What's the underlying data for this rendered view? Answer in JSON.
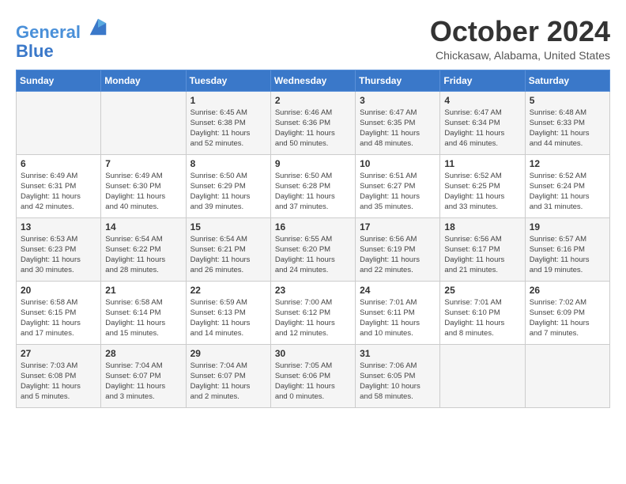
{
  "header": {
    "logo_line1": "General",
    "logo_line2": "Blue",
    "month": "October 2024",
    "location": "Chickasaw, Alabama, United States"
  },
  "weekdays": [
    "Sunday",
    "Monday",
    "Tuesday",
    "Wednesday",
    "Thursday",
    "Friday",
    "Saturday"
  ],
  "weeks": [
    [
      {
        "day": "",
        "info": ""
      },
      {
        "day": "",
        "info": ""
      },
      {
        "day": "1",
        "info": "Sunrise: 6:45 AM\nSunset: 6:38 PM\nDaylight: 11 hours\nand 52 minutes."
      },
      {
        "day": "2",
        "info": "Sunrise: 6:46 AM\nSunset: 6:36 PM\nDaylight: 11 hours\nand 50 minutes."
      },
      {
        "day": "3",
        "info": "Sunrise: 6:47 AM\nSunset: 6:35 PM\nDaylight: 11 hours\nand 48 minutes."
      },
      {
        "day": "4",
        "info": "Sunrise: 6:47 AM\nSunset: 6:34 PM\nDaylight: 11 hours\nand 46 minutes."
      },
      {
        "day": "5",
        "info": "Sunrise: 6:48 AM\nSunset: 6:33 PM\nDaylight: 11 hours\nand 44 minutes."
      }
    ],
    [
      {
        "day": "6",
        "info": "Sunrise: 6:49 AM\nSunset: 6:31 PM\nDaylight: 11 hours\nand 42 minutes."
      },
      {
        "day": "7",
        "info": "Sunrise: 6:49 AM\nSunset: 6:30 PM\nDaylight: 11 hours\nand 40 minutes."
      },
      {
        "day": "8",
        "info": "Sunrise: 6:50 AM\nSunset: 6:29 PM\nDaylight: 11 hours\nand 39 minutes."
      },
      {
        "day": "9",
        "info": "Sunrise: 6:50 AM\nSunset: 6:28 PM\nDaylight: 11 hours\nand 37 minutes."
      },
      {
        "day": "10",
        "info": "Sunrise: 6:51 AM\nSunset: 6:27 PM\nDaylight: 11 hours\nand 35 minutes."
      },
      {
        "day": "11",
        "info": "Sunrise: 6:52 AM\nSunset: 6:25 PM\nDaylight: 11 hours\nand 33 minutes."
      },
      {
        "day": "12",
        "info": "Sunrise: 6:52 AM\nSunset: 6:24 PM\nDaylight: 11 hours\nand 31 minutes."
      }
    ],
    [
      {
        "day": "13",
        "info": "Sunrise: 6:53 AM\nSunset: 6:23 PM\nDaylight: 11 hours\nand 30 minutes."
      },
      {
        "day": "14",
        "info": "Sunrise: 6:54 AM\nSunset: 6:22 PM\nDaylight: 11 hours\nand 28 minutes."
      },
      {
        "day": "15",
        "info": "Sunrise: 6:54 AM\nSunset: 6:21 PM\nDaylight: 11 hours\nand 26 minutes."
      },
      {
        "day": "16",
        "info": "Sunrise: 6:55 AM\nSunset: 6:20 PM\nDaylight: 11 hours\nand 24 minutes."
      },
      {
        "day": "17",
        "info": "Sunrise: 6:56 AM\nSunset: 6:19 PM\nDaylight: 11 hours\nand 22 minutes."
      },
      {
        "day": "18",
        "info": "Sunrise: 6:56 AM\nSunset: 6:17 PM\nDaylight: 11 hours\nand 21 minutes."
      },
      {
        "day": "19",
        "info": "Sunrise: 6:57 AM\nSunset: 6:16 PM\nDaylight: 11 hours\nand 19 minutes."
      }
    ],
    [
      {
        "day": "20",
        "info": "Sunrise: 6:58 AM\nSunset: 6:15 PM\nDaylight: 11 hours\nand 17 minutes."
      },
      {
        "day": "21",
        "info": "Sunrise: 6:58 AM\nSunset: 6:14 PM\nDaylight: 11 hours\nand 15 minutes."
      },
      {
        "day": "22",
        "info": "Sunrise: 6:59 AM\nSunset: 6:13 PM\nDaylight: 11 hours\nand 14 minutes."
      },
      {
        "day": "23",
        "info": "Sunrise: 7:00 AM\nSunset: 6:12 PM\nDaylight: 11 hours\nand 12 minutes."
      },
      {
        "day": "24",
        "info": "Sunrise: 7:01 AM\nSunset: 6:11 PM\nDaylight: 11 hours\nand 10 minutes."
      },
      {
        "day": "25",
        "info": "Sunrise: 7:01 AM\nSunset: 6:10 PM\nDaylight: 11 hours\nand 8 minutes."
      },
      {
        "day": "26",
        "info": "Sunrise: 7:02 AM\nSunset: 6:09 PM\nDaylight: 11 hours\nand 7 minutes."
      }
    ],
    [
      {
        "day": "27",
        "info": "Sunrise: 7:03 AM\nSunset: 6:08 PM\nDaylight: 11 hours\nand 5 minutes."
      },
      {
        "day": "28",
        "info": "Sunrise: 7:04 AM\nSunset: 6:07 PM\nDaylight: 11 hours\nand 3 minutes."
      },
      {
        "day": "29",
        "info": "Sunrise: 7:04 AM\nSunset: 6:07 PM\nDaylight: 11 hours\nand 2 minutes."
      },
      {
        "day": "30",
        "info": "Sunrise: 7:05 AM\nSunset: 6:06 PM\nDaylight: 11 hours\nand 0 minutes."
      },
      {
        "day": "31",
        "info": "Sunrise: 7:06 AM\nSunset: 6:05 PM\nDaylight: 10 hours\nand 58 minutes."
      },
      {
        "day": "",
        "info": ""
      },
      {
        "day": "",
        "info": ""
      }
    ]
  ]
}
